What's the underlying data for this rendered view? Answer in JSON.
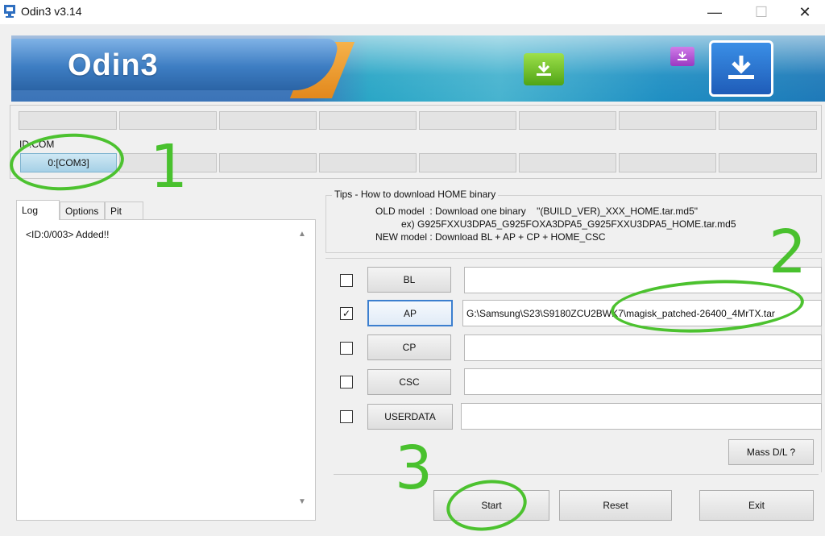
{
  "window": {
    "title": "Odin3 v3.14",
    "minimize": "—",
    "maximize": "☐",
    "close": "✕"
  },
  "banner": {
    "logo_text": "Odin3",
    "icons": [
      "download-icon",
      "download-icon",
      "download-icon"
    ]
  },
  "ports": {
    "id_label": "ID:COM",
    "active_com": "0:[COM3]"
  },
  "tabs": [
    {
      "label": "Log",
      "active": true
    },
    {
      "label": "Options",
      "active": false
    },
    {
      "label": "Pit",
      "active": false
    }
  ],
  "log": {
    "text": "<ID:0/003> Added!!"
  },
  "tips": {
    "title": "Tips - How to download HOME binary",
    "line1": "OLD model  : Download one binary    \"(BUILD_VER)_XXX_HOME.tar.md5\"",
    "line2": "ex) G925FXXU3DPA5_G925FOXA3DPA5_G925FXXU3DPA5_HOME.tar.md5",
    "line3": "NEW model : Download BL + AP + CP + HOME_CSC"
  },
  "files": [
    {
      "key": "bl",
      "label": "BL",
      "checked": false,
      "path": ""
    },
    {
      "key": "ap",
      "label": "AP",
      "checked": true,
      "path": "G:\\Samsung\\S23\\S9180ZCU2BWK7\\magisk_patched-26400_4MrTX.tar"
    },
    {
      "key": "cp",
      "label": "CP",
      "checked": false,
      "path": ""
    },
    {
      "key": "csc",
      "label": "CSC",
      "checked": false,
      "path": ""
    },
    {
      "key": "userdata",
      "label": "USERDATA",
      "checked": false,
      "path": ""
    }
  ],
  "checkmark": "✓",
  "actions": {
    "mass_dl": "Mass D/L ?",
    "start": "Start",
    "reset": "Reset",
    "exit": "Exit"
  },
  "annotations": {
    "one": "1",
    "two": "2",
    "three": "3",
    "color": "#4cc22f"
  },
  "colors": {
    "banner_blue": "#3b74b8",
    "focus_blue": "#3c7fcf",
    "com_active": "#a5d0e6"
  }
}
